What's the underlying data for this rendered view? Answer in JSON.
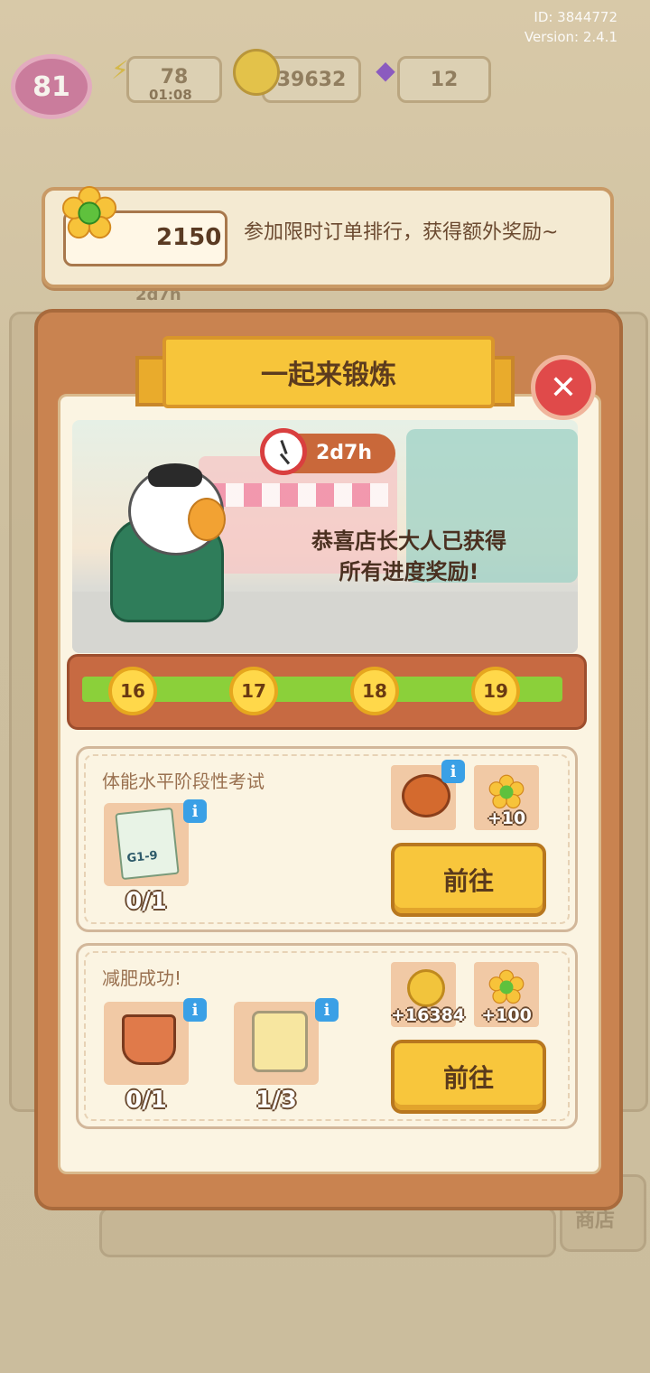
{
  "meta": {
    "id": "ID: 3844772",
    "version": "Version: 2.4.1"
  },
  "top_bar": {
    "level": "81",
    "energy": "78",
    "energy_timer": "01:08",
    "coins": "39632",
    "gems": "12"
  },
  "bg": {
    "event_timer": "2d7h",
    "shop_label": "商店"
  },
  "banner": {
    "score": "2150",
    "text": "参加限时订单排行，获得额外奖励~"
  },
  "panel": {
    "title": "一起来锻炼",
    "timer": "2d7h",
    "congrats_line1": "恭喜店长大人已获得",
    "congrats_line2": "所有进度奖励!"
  },
  "progress": {
    "milestones": [
      "16",
      "17",
      "18",
      "19"
    ],
    "fill_fraction": 1.0
  },
  "tasks": [
    {
      "title": "体能水平阶段性考试",
      "items": [
        {
          "name": "exam-paper",
          "count": "0/1",
          "label": "G1-9"
        }
      ],
      "rewards": [
        {
          "name": "gear-machine",
          "amount": ""
        },
        {
          "name": "flower",
          "amount": "+10"
        }
      ],
      "button": "前往"
    },
    {
      "title": "减肥成功!",
      "items": [
        {
          "name": "bucket",
          "count": "0/1"
        },
        {
          "name": "cream-jar",
          "count": "1/3"
        }
      ],
      "rewards": [
        {
          "name": "coin",
          "amount": "+16384"
        },
        {
          "name": "flower",
          "amount": "+100"
        }
      ],
      "button": "前往"
    }
  ],
  "colors": {
    "panel": "#c98350",
    "ribbon": "#f7c53a",
    "progress_fill": "#8bd03a",
    "close": "#e04a4a",
    "button": "#f8c63c"
  }
}
